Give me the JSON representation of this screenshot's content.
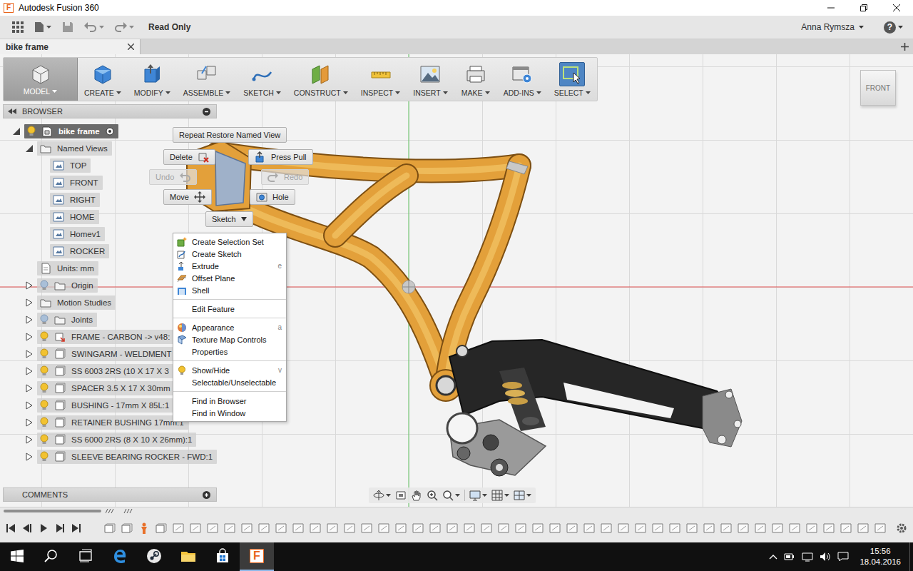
{
  "window": {
    "title": "Autodesk Fusion 360",
    "logo": "F"
  },
  "quick_access": {
    "status": "Read Only",
    "user": "Anna Rymsza",
    "help": "?"
  },
  "document_tabs": [
    {
      "label": "bike frame",
      "selected": true
    }
  ],
  "toolbar": [
    {
      "label": "MODEL",
      "kind": "model",
      "selected": true
    },
    {
      "label": "CREATE",
      "kind": "create",
      "selected": false
    },
    {
      "label": "MODIFY",
      "kind": "modify",
      "selected": false
    },
    {
      "label": "ASSEMBLE",
      "kind": "assemble",
      "selected": false
    },
    {
      "label": "SKETCH",
      "kind": "sketch",
      "selected": false
    },
    {
      "label": "CONSTRUCT",
      "kind": "construct",
      "selected": false
    },
    {
      "label": "INSPECT",
      "kind": "inspect",
      "selected": false
    },
    {
      "label": "INSERT",
      "kind": "insert",
      "selected": false
    },
    {
      "label": "MAKE",
      "kind": "make",
      "selected": false
    },
    {
      "label": "ADD-INS",
      "kind": "addins",
      "selected": false
    },
    {
      "label": "SELECT",
      "kind": "select",
      "selected": true
    }
  ],
  "view_cube": {
    "label": "FRONT"
  },
  "browser": {
    "title": "BROWSER",
    "items": [
      {
        "label": "bike frame",
        "level": 0,
        "kind": "document",
        "expandable": true,
        "expanded": true,
        "visible": true,
        "active": true
      },
      {
        "label": "Named Views",
        "level": 1,
        "kind": "folder",
        "expandable": true,
        "expanded": true,
        "visible": null,
        "active": false
      },
      {
        "label": "TOP",
        "level": 2,
        "kind": "view",
        "expandable": false,
        "expanded": false,
        "visible": null,
        "active": false
      },
      {
        "label": "FRONT",
        "level": 2,
        "kind": "view",
        "expandable": false,
        "expanded": false,
        "visible": null,
        "active": false
      },
      {
        "label": "RIGHT",
        "level": 2,
        "kind": "view",
        "expandable": false,
        "expanded": false,
        "visible": null,
        "active": false
      },
      {
        "label": "HOME",
        "level": 2,
        "kind": "view",
        "expandable": false,
        "expanded": false,
        "visible": null,
        "active": false
      },
      {
        "label": "Homev1",
        "level": 2,
        "kind": "view",
        "expandable": false,
        "expanded": false,
        "visible": null,
        "active": false
      },
      {
        "label": "ROCKER",
        "level": 2,
        "kind": "view",
        "expandable": false,
        "expanded": false,
        "visible": null,
        "active": false
      },
      {
        "label": "Units: mm",
        "level": 1,
        "kind": "units",
        "expandable": false,
        "expanded": false,
        "visible": null,
        "active": false
      },
      {
        "label": "Origin",
        "level": 1,
        "kind": "folder",
        "expandable": true,
        "expanded": false,
        "visible": false,
        "active": false
      },
      {
        "label": "Motion Studies",
        "level": 1,
        "kind": "folder",
        "expandable": true,
        "expanded": false,
        "visible": null,
        "active": false
      },
      {
        "label": "Joints",
        "level": 1,
        "kind": "folder",
        "expandable": true,
        "expanded": false,
        "visible": false,
        "active": false
      },
      {
        "label": "FRAME - CARBON -> v48:",
        "level": 1,
        "kind": "linked-component",
        "expandable": true,
        "expanded": false,
        "visible": true,
        "active": false
      },
      {
        "label": "SWINGARM - WELDMENT",
        "level": 1,
        "kind": "component",
        "expandable": true,
        "expanded": false,
        "visible": true,
        "active": false
      },
      {
        "label": "SS 6003 2RS (10 X 17 X 3",
        "level": 1,
        "kind": "component",
        "expandable": true,
        "expanded": false,
        "visible": true,
        "active": false
      },
      {
        "label": "SPACER 3.5 X 17 X 30mm",
        "level": 1,
        "kind": "component",
        "expandable": true,
        "expanded": false,
        "visible": true,
        "active": false
      },
      {
        "label": "BUSHING - 17mm X 85L:1",
        "level": 1,
        "kind": "component",
        "expandable": true,
        "expanded": false,
        "visible": true,
        "active": false
      },
      {
        "label": "RETAINER BUSHING 17mm:1",
        "level": 1,
        "kind": "component",
        "expandable": true,
        "expanded": false,
        "visible": true,
        "active": false
      },
      {
        "label": "SS 6000 2RS (8 X 10 X 26mm):1",
        "level": 1,
        "kind": "component",
        "expandable": true,
        "expanded": false,
        "visible": true,
        "active": false
      },
      {
        "label": "SLEEVE BEARING ROCKER - FWD:1",
        "level": 1,
        "kind": "component",
        "expandable": true,
        "expanded": false,
        "visible": true,
        "active": false
      }
    ]
  },
  "marking_menu": [
    {
      "label": "Repeat Restore Named View",
      "kind": "plain",
      "disabled": false
    },
    {
      "label": "Delete",
      "kind": "delete",
      "disabled": false
    },
    {
      "label": "Press Pull",
      "kind": "presspull",
      "disabled": false
    },
    {
      "label": "Undo",
      "kind": "undo",
      "disabled": true
    },
    {
      "label": "Redo",
      "kind": "redo",
      "disabled": true
    },
    {
      "label": "Move",
      "kind": "move",
      "disabled": false
    },
    {
      "label": "Hole",
      "kind": "hole",
      "disabled": false
    },
    {
      "label": "Sketch",
      "kind": "dropdown",
      "disabled": false
    }
  ],
  "context_menu": [
    [
      {
        "label": "Create Selection Set",
        "kind": "selection-set",
        "shortcut": ""
      },
      {
        "label": "Create Sketch",
        "kind": "sketch",
        "shortcut": ""
      },
      {
        "label": "Extrude",
        "kind": "extrude",
        "shortcut": "e"
      },
      {
        "label": "Offset Plane",
        "kind": "plane",
        "shortcut": ""
      },
      {
        "label": "Shell",
        "kind": "shell",
        "shortcut": ""
      }
    ],
    [
      {
        "label": "Edit Feature",
        "kind": "none",
        "shortcut": ""
      }
    ],
    [
      {
        "label": "Appearance",
        "kind": "appearance",
        "shortcut": "a"
      },
      {
        "label": "Texture Map Controls",
        "kind": "texture",
        "shortcut": ""
      },
      {
        "label": "Properties",
        "kind": "none",
        "shortcut": ""
      }
    ],
    [
      {
        "label": "Show/Hide",
        "kind": "bulb",
        "shortcut": "v"
      },
      {
        "label": "Selectable/Unselectable",
        "kind": "none",
        "shortcut": ""
      }
    ],
    [
      {
        "label": "Find in Browser",
        "kind": "none",
        "shortcut": ""
      },
      {
        "label": "Find in Window",
        "kind": "none",
        "shortcut": ""
      }
    ]
  ],
  "comments": {
    "title": "COMMENTS"
  },
  "timeline": {
    "items": [
      "component",
      "component",
      "marker",
      "component",
      "joint",
      "joint",
      "joint",
      "joint",
      "joint",
      "joint",
      "joint",
      "joint",
      "joint",
      "joint",
      "joint",
      "joint",
      "joint",
      "joint",
      "joint",
      "joint",
      "joint",
      "joint",
      "joint",
      "joint",
      "joint",
      "joint",
      "joint",
      "joint",
      "joint",
      "joint",
      "joint",
      "joint",
      "joint",
      "joint",
      "joint",
      "joint",
      "joint",
      "joint",
      "joint",
      "joint",
      "joint",
      "joint",
      "joint",
      "joint",
      "joint",
      "joint"
    ]
  },
  "taskbar": {
    "apps": [
      {
        "kind": "start",
        "selected": false
      },
      {
        "kind": "search",
        "selected": false
      },
      {
        "kind": "task-view",
        "selected": false
      },
      {
        "kind": "edge",
        "selected": false
      },
      {
        "kind": "steam",
        "selected": false
      },
      {
        "kind": "explorer",
        "selected": false
      },
      {
        "kind": "store",
        "selected": false
      },
      {
        "kind": "fusion",
        "selected": true
      }
    ],
    "time": "15:56",
    "date": "18.04.2016"
  }
}
